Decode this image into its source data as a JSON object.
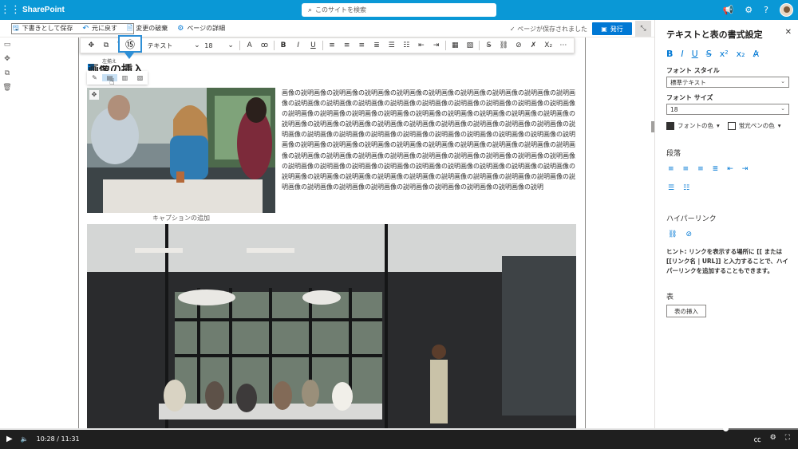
{
  "suite": {
    "app_name": "SharePoint",
    "search_placeholder": "このサイトを検索"
  },
  "command_bar": {
    "save_draft": "下書きとして保存",
    "undo": "元に戻す",
    "discard": "変更の破棄",
    "page_details": "ページの詳細",
    "saved_status": "ページが保存されました",
    "publish": "発行"
  },
  "rte_toolbar": {
    "text_style": "テキスト",
    "font_size": "18"
  },
  "callout": {
    "number": "⑮",
    "tooltip": "左揃え"
  },
  "content": {
    "heading": "画像の挿入",
    "caption": "キャプションの追加",
    "paragraph": "画像の説明画像の説明画像の説明画像の説明画像の説明画像の説明画像の説明画像の説明画像の説明画像の説明画像の説明画像の説明画像の説明画像の説明画像の説明画像の説明画像の説明画像の説明画像の説明画像の説明画像の説明画像の説明画像の説明画像の説明画像の説明画像の説明画像の説明画像の説明画像の説明画像の説明画像の説明画像の説明画像の説明画像の説明画像の説明画像の説明画像の説明画像の説明画像の説明画像の説明画像の説明画像の説明画像の説明画像の説明画像の説明画像の説明画像の説明画像の説明画像の説明画像の説明画像の説明画像の説明画像の説明画像の説明画像の説明画像の説明画像の説明画像の説明画像の説明画像の説明画像の説明画像の説明画像の説明画像の説明画像の説明画像の説明画像の説明画像の説明画像の説明画像の説明画像の説明画像の説明画像の説明画像の説明画像の説明画像の説明画像の説明画像の説明画像の説明画像の説明画像の説明画像の説明画像の説明画像の説明画像の説明画像の説明画像の説明画像の説明画像の説明画像の説明画像の説明"
  },
  "format_panel": {
    "title": "テキストと表の書式設定",
    "font_style_label": "フォント スタイル",
    "font_style_value": "標準テキスト",
    "font_size_label": "フォント サイズ",
    "font_size_value": "18",
    "font_color": "フォントの色",
    "highlight_color": "蛍光ペンの色",
    "paragraph_label": "段落",
    "hyperlink_label": "ハイパーリンク",
    "hint": "ヒント: リンクを表示する場所に [[ または [[リンク名 | URL]] と入力することで、ハイパーリンクを追加することもできます。",
    "table_label": "表",
    "insert_table": "表の挿入"
  },
  "player": {
    "time": "10:28 / 11:31",
    "progress": 0.909
  },
  "colors": {
    "suite_bar": "#0a98d6",
    "accent": "#0078d4"
  }
}
